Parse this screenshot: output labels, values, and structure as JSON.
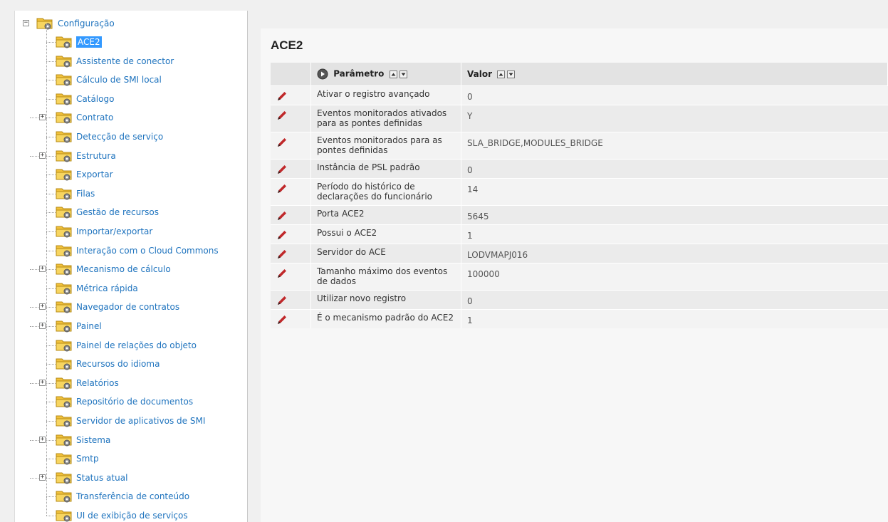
{
  "tree": {
    "root_label": "Configuração",
    "items": [
      {
        "label": "ACE2",
        "expandable": false,
        "selected": true
      },
      {
        "label": "Assistente de conector",
        "expandable": false
      },
      {
        "label": "Cálculo de SMI local",
        "expandable": false
      },
      {
        "label": "Catálogo",
        "expandable": false
      },
      {
        "label": "Contrato",
        "expandable": true
      },
      {
        "label": "Detecção de serviço",
        "expandable": false
      },
      {
        "label": "Estrutura",
        "expandable": true
      },
      {
        "label": "Exportar",
        "expandable": false
      },
      {
        "label": "Filas",
        "expandable": false
      },
      {
        "label": "Gestão de recursos",
        "expandable": false
      },
      {
        "label": "Importar/exportar",
        "expandable": false
      },
      {
        "label": "Interação com o Cloud Commons",
        "expandable": false
      },
      {
        "label": "Mecanismo de cálculo",
        "expandable": true
      },
      {
        "label": "Métrica rápida",
        "expandable": false
      },
      {
        "label": "Navegador de contratos",
        "expandable": true
      },
      {
        "label": "Painel",
        "expandable": true
      },
      {
        "label": "Painel de relações do objeto",
        "expandable": false
      },
      {
        "label": "Recursos do idioma",
        "expandable": false
      },
      {
        "label": "Relatórios",
        "expandable": true
      },
      {
        "label": "Repositório de documentos",
        "expandable": false
      },
      {
        "label": "Servidor de aplicativos de SMI",
        "expandable": false
      },
      {
        "label": "Sistema",
        "expandable": true
      },
      {
        "label": "Smtp",
        "expandable": false
      },
      {
        "label": "Status atual",
        "expandable": true
      },
      {
        "label": "Transferência de conteúdo",
        "expandable": false
      },
      {
        "label": "UI de exibição de serviços",
        "expandable": false
      }
    ]
  },
  "panel": {
    "title": "ACE2",
    "columns": {
      "param": "Parâmetro",
      "value": "Valor"
    },
    "rows": [
      {
        "param": "Ativar o registro avançado",
        "value": "0"
      },
      {
        "param": "Eventos monitorados ativados para as pontes definidas",
        "value": "Y"
      },
      {
        "param": "Eventos monitorados para as pontes definidas",
        "value": "SLA_BRIDGE,MODULES_BRIDGE"
      },
      {
        "param": "Instância de PSL padrão",
        "value": "0"
      },
      {
        "param": "Período do histórico de declarações do funcionário",
        "value": "14"
      },
      {
        "param": "Porta ACE2",
        "value": "5645"
      },
      {
        "param": "Possui o ACE2",
        "value": "1"
      },
      {
        "param": "Servidor do ACE",
        "value": "LODVMAPJ016"
      },
      {
        "param": "Tamanho máximo dos eventos de dados",
        "value": "100000"
      },
      {
        "param": "Utilizar novo registro",
        "value": "0"
      },
      {
        "param": "É o mecanismo padrão do ACE2",
        "value": "1"
      }
    ]
  },
  "icons": {
    "folder": "folder-gear-icon",
    "edit": "pencil-icon",
    "sort_up": "sort-up-icon",
    "sort_down": "sort-down-icon",
    "play": "play-circle-icon"
  },
  "colors": {
    "link": "#1e73be",
    "selected_bg": "#3399ff",
    "header_bg": "#e3e3e3",
    "pencil": "#c0282a"
  }
}
